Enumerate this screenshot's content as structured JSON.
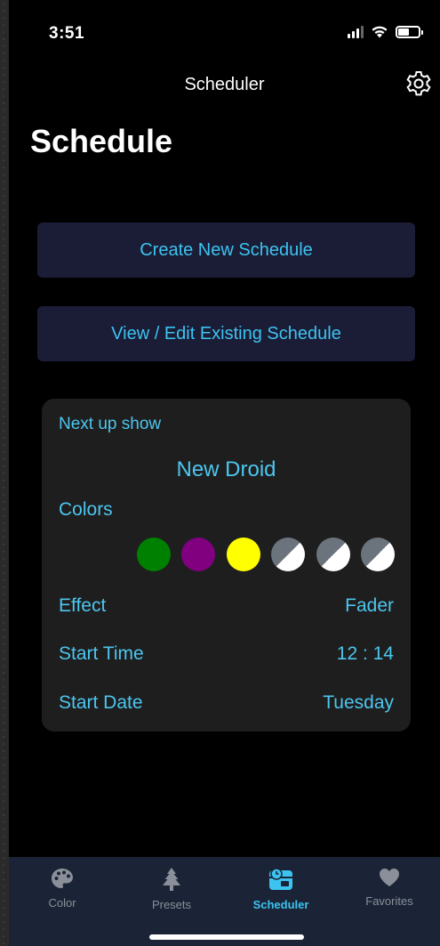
{
  "status": {
    "time": "3:51",
    "battery_level": 0.55
  },
  "nav": {
    "title": "Scheduler",
    "settings_icon": "gear-icon"
  },
  "page": {
    "title": "Schedule"
  },
  "actions": {
    "create_label": "Create New Schedule",
    "view_label": "View / Edit Existing Schedule"
  },
  "next_up": {
    "kicker": "Next up show",
    "name": "New Droid",
    "colors_label": "Colors",
    "colors": [
      "#008000",
      "#800080",
      "#ffff00",
      "empty",
      "empty",
      "empty"
    ],
    "effect_label": "Effect",
    "effect_value": "Fader",
    "start_time_label": "Start Time",
    "start_time_value": "12 : 14",
    "start_date_label": "Start Date",
    "start_date_value": "Tuesday"
  },
  "tabs": [
    {
      "label": "Color",
      "icon": "palette-icon",
      "active": false
    },
    {
      "label": "Presets",
      "icon": "tree-icon",
      "active": false
    },
    {
      "label": "Scheduler",
      "icon": "calendar-clock-icon",
      "active": true
    },
    {
      "label": "Favorites",
      "icon": "heart-icon",
      "active": false
    }
  ],
  "theme": {
    "accent": "#3cc3f0",
    "button_bg": "#1b1c36",
    "card_bg": "#1e1e1e",
    "tab_bar_bg": "#1a2436"
  }
}
